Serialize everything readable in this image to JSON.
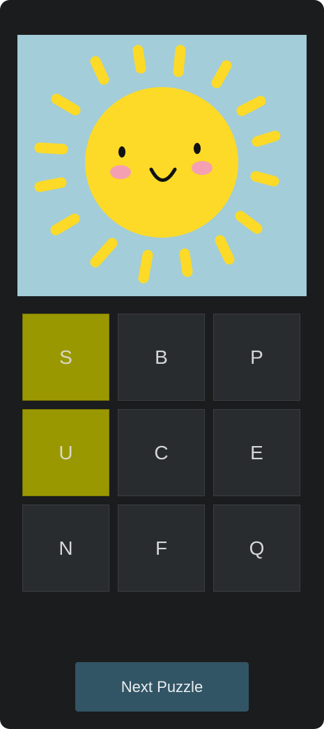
{
  "puzzle": {
    "image_description_icon": "smiling-sun-icon",
    "colors": {
      "sky": "#a3cdd8",
      "sun": "#fcda27",
      "cheeks": "#f4a0b2",
      "face": "#111111"
    }
  },
  "grid": {
    "tiles": [
      {
        "letter": "S",
        "selected": true
      },
      {
        "letter": "B",
        "selected": false
      },
      {
        "letter": "P",
        "selected": false
      },
      {
        "letter": "U",
        "selected": true
      },
      {
        "letter": "C",
        "selected": false
      },
      {
        "letter": "E",
        "selected": false
      },
      {
        "letter": "N",
        "selected": false
      },
      {
        "letter": "F",
        "selected": false
      },
      {
        "letter": "Q",
        "selected": false
      }
    ],
    "colors": {
      "tile": "#282c2f",
      "selected": "#9a9800"
    }
  },
  "controls": {
    "next_label": "Next Puzzle",
    "button_color": "#325565"
  }
}
